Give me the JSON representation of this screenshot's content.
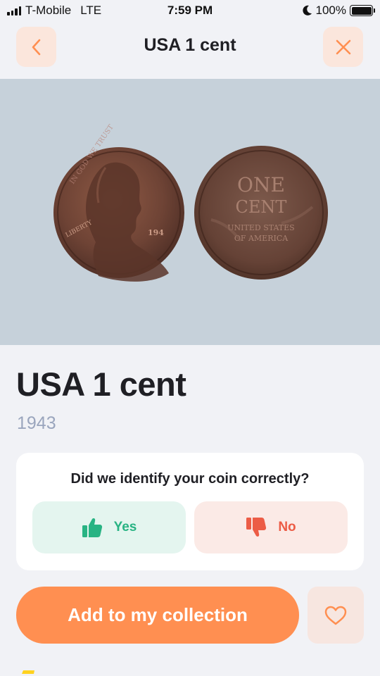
{
  "status_bar": {
    "carrier": "T-Mobile",
    "network": "LTE",
    "time": "7:59 PM",
    "battery": "100%",
    "icons": [
      "signal-icon",
      "moon-icon",
      "battery-icon"
    ]
  },
  "header": {
    "title": "USA 1 cent",
    "back_icon": "chevron-left-icon",
    "close_icon": "close-icon"
  },
  "coin": {
    "title": "USA 1 cent",
    "year": "1943",
    "obverse_text": [
      "IN GOD WE TRUST",
      "LIBERTY",
      "194"
    ],
    "reverse_text": [
      "ONE",
      "CENT",
      "UNITED STATES",
      "OF AMERICA"
    ]
  },
  "identify": {
    "question": "Did we identify your coin correctly?",
    "yes_label": "Yes",
    "no_label": "No",
    "yes_icon": "thumbs-up-icon",
    "no_icon": "thumbs-down-icon"
  },
  "actions": {
    "add_label": "Add to my collection",
    "favorite_icon": "heart-icon"
  },
  "colors": {
    "accent": "#ff8f51",
    "yes": "#28b383",
    "no": "#ec5c46",
    "muted": "#9aa5bd",
    "background": "#f1f2f6"
  }
}
